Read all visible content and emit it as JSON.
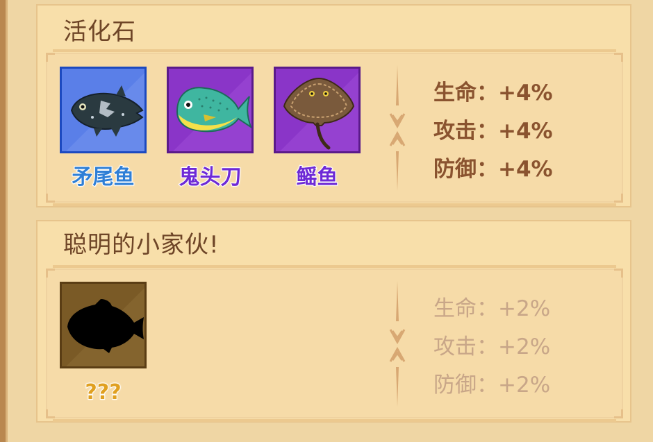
{
  "sets": [
    {
      "title": "活化石",
      "fish": [
        {
          "name": "矛尾鱼",
          "rarity": "blue",
          "box_color": "#5a7fe8",
          "border_color": "#1c49c0",
          "label_color": "#2f7fd6",
          "icon": "coelacanth-icon"
        },
        {
          "name": "鬼头刀",
          "rarity": "purple",
          "box_color": "#8a35c8",
          "border_color": "#5a1a8a",
          "label_color": "#6e2ad6",
          "icon": "mahi-mahi-icon"
        },
        {
          "name": "鳐鱼",
          "rarity": "purple",
          "box_color": "#8a35c8",
          "border_color": "#5a1a8a",
          "label_color": "#6e2ad6",
          "icon": "stingray-icon"
        }
      ],
      "bonuses": [
        "生命：+4%",
        "攻击：+4%",
        "防御：+4%"
      ],
      "active": true
    },
    {
      "title": "聪明的小家伙!",
      "fish": [
        {
          "name": "???",
          "rarity": "unknown",
          "box_color": "#7a5a26",
          "border_color": "#5a3d14",
          "label_color": "#e0a020",
          "icon": "unknown-fish-silhouette-icon"
        }
      ],
      "bonuses": [
        "生命：+2%",
        "攻击：+2%",
        "防御：+2%"
      ],
      "active": false
    }
  ]
}
